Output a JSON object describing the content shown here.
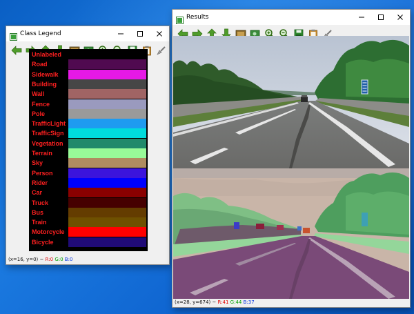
{
  "legend_window": {
    "title": "Class Legend",
    "status": {
      "coord": "(x=16, y=0) ~ ",
      "r": "R:0",
      "g": "G:0",
      "b": "B:0"
    },
    "classes": [
      {
        "name": "Unlabeled",
        "color": "#000000"
      },
      {
        "name": "Road",
        "color": "#500a50"
      },
      {
        "name": "Sidewalk",
        "color": "#e619e6"
      },
      {
        "name": "Building",
        "color": "#464646"
      },
      {
        "name": "Wall",
        "color": "#a06464"
      },
      {
        "name": "Fence",
        "color": "#9a9abe"
      },
      {
        "name": "Pole",
        "color": "#9a9a9a"
      },
      {
        "name": "TrafficLight",
        "color": "#1e9bf0"
      },
      {
        "name": "TrafficSign",
        "color": "#00dcdc"
      },
      {
        "name": "Vegetation",
        "color": "#208a6b"
      },
      {
        "name": "Terrain",
        "color": "#98fb98"
      },
      {
        "name": "Sky",
        "color": "#b08c60"
      },
      {
        "name": "Person",
        "color": "#3c14dc"
      },
      {
        "name": "Rider",
        "color": "#0000ff"
      },
      {
        "name": "Car",
        "color": "#8a0000"
      },
      {
        "name": "Truck",
        "color": "#460000"
      },
      {
        "name": "Bus",
        "color": "#643c00"
      },
      {
        "name": "Train",
        "color": "#6e5000"
      },
      {
        "name": "Motorcycle",
        "color": "#ff0000"
      },
      {
        "name": "Bicycle",
        "color": "#200b77"
      }
    ]
  },
  "results_window": {
    "title": "Results",
    "status": {
      "coord": "(x=28, y=674) ~ ",
      "r": "R:41",
      "g": "G:44",
      "b": "B:37"
    }
  }
}
